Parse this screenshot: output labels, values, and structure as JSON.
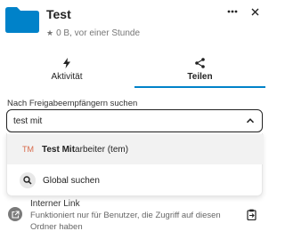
{
  "file": {
    "title": "Test",
    "meta": "0 B, vor einer Stunde",
    "icon": "folder-icon",
    "color": "#0082c9"
  },
  "header_actions": {
    "more": "more-icon",
    "close": "close-icon"
  },
  "tabs": [
    {
      "label": "Aktivität",
      "icon": "lightning-icon",
      "active": false
    },
    {
      "label": "Teilen",
      "icon": "share-icon",
      "active": true
    }
  ],
  "search": {
    "label": "Nach Freigabeempfängern suchen",
    "value": "test mit"
  },
  "results": [
    {
      "avatar_initials": "TM",
      "match": "Test Mit",
      "rest": "arbeiter (tem)",
      "type": "user"
    },
    {
      "label": "Global suchen",
      "icon": "search-icon",
      "type": "global"
    }
  ],
  "internal_link": {
    "title": "Interner Link",
    "description": "Funktioniert nur für Benutzer, die Zugriff auf diesen Ordner haben"
  },
  "accent_color": "#0082c9",
  "avatar_color": "#d86a4b"
}
